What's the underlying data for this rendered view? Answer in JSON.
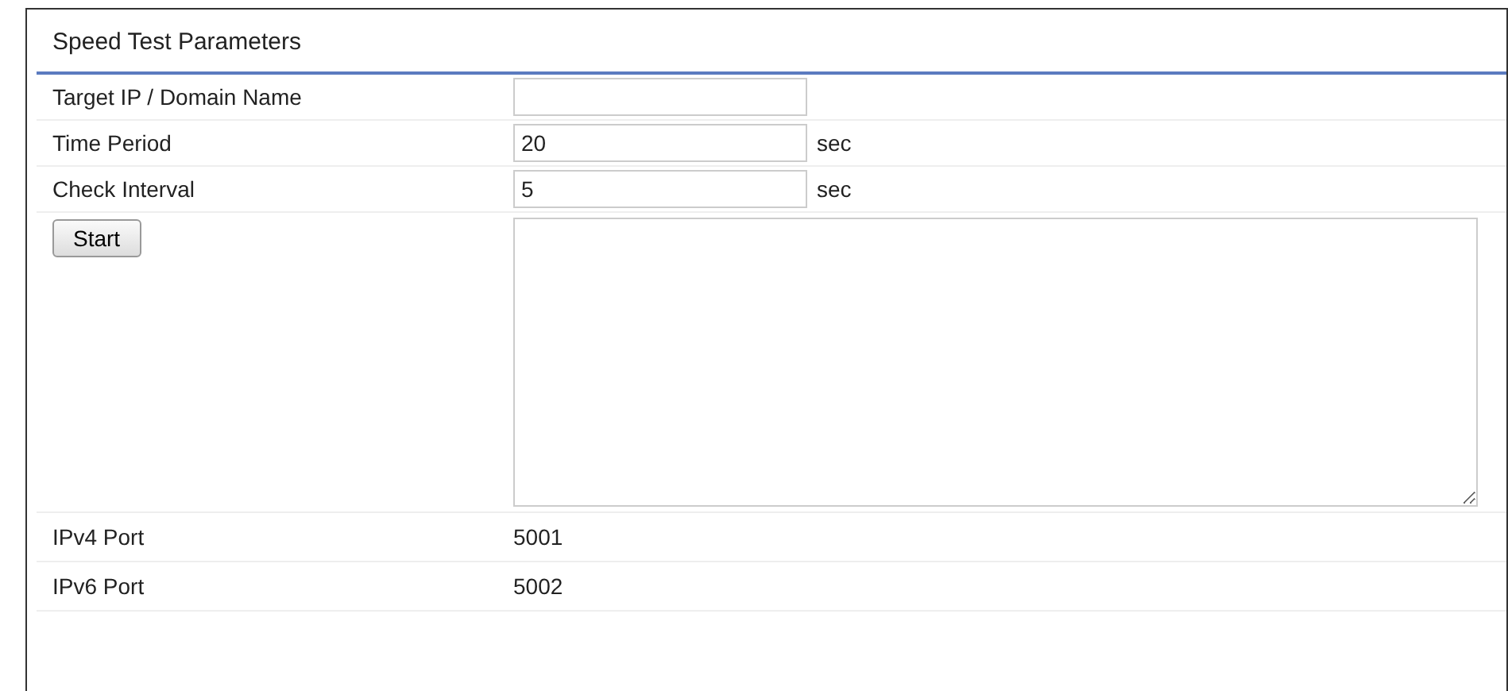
{
  "panel": {
    "title": "Speed Test Parameters"
  },
  "rows": [
    {
      "kind": "input",
      "label": "Target IP / Domain Name",
      "value": ""
    },
    {
      "kind": "input",
      "label": "Time Period",
      "value": "20",
      "unit": "sec"
    },
    {
      "kind": "input",
      "label": "Check Interval",
      "value": "5",
      "unit": "sec"
    },
    {
      "kind": "action",
      "button": "Start"
    },
    {
      "kind": "text",
      "label": "IPv4 Port",
      "value": "5001"
    },
    {
      "kind": "text",
      "label": "IPv6 Port",
      "value": "5002"
    }
  ]
}
